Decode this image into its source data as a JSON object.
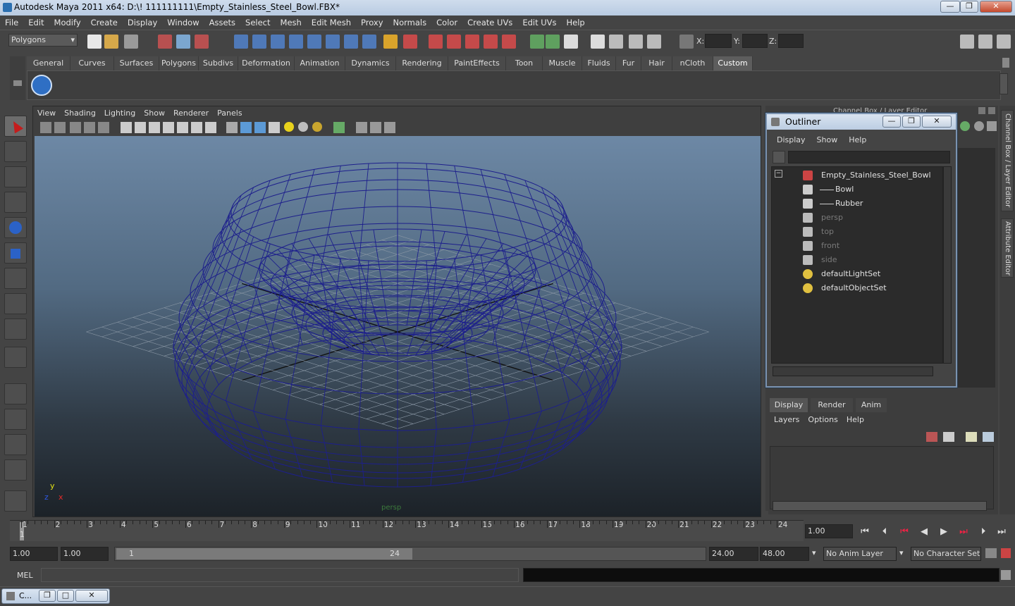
{
  "window": {
    "title": "Autodesk Maya 2011 x64: D:\\! 111111111\\Empty_Stainless_Steel_Bowl.FBX*",
    "minimize": "—",
    "maximize": "❐",
    "close": "✕"
  },
  "menubar": [
    "File",
    "Edit",
    "Modify",
    "Create",
    "Display",
    "Window",
    "Assets",
    "Select",
    "Mesh",
    "Edit Mesh",
    "Proxy",
    "Normals",
    "Color",
    "Create UVs",
    "Edit UVs",
    "Help"
  ],
  "toolbar": {
    "mode": "Polygons",
    "x_label": "X:",
    "y_label": "Y:",
    "z_label": "Z:",
    "x_value": "",
    "y_value": "",
    "z_value": ""
  },
  "shelf": {
    "tabs": [
      "General",
      "Curves",
      "Surfaces",
      "Polygons",
      "Subdivs",
      "Deformation",
      "Animation",
      "Dynamics",
      "Rendering",
      "PaintEffects",
      "Toon",
      "Muscle",
      "Fluids",
      "Fur",
      "Hair",
      "nCloth",
      "Custom"
    ],
    "active": "Custom"
  },
  "viewport": {
    "menu": [
      "View",
      "Shading",
      "Lighting",
      "Show",
      "Renderer",
      "Panels"
    ],
    "camera_label": "persp",
    "axis_x": "x",
    "axis_y": "y",
    "axis_z": "z"
  },
  "outliner": {
    "title": "Outliner",
    "menu": [
      "Display",
      "Show",
      "Help"
    ],
    "items": [
      {
        "label": "Empty_Stainless_Steel_Bowl",
        "indent": 0,
        "dim": false,
        "icon": "transform-icon"
      },
      {
        "label": "Bowl",
        "indent": 1,
        "dim": false,
        "icon": "mesh-icon"
      },
      {
        "label": "Rubber",
        "indent": 1,
        "dim": false,
        "icon": "mesh-icon"
      },
      {
        "label": "persp",
        "indent": 0,
        "dim": true,
        "icon": "camera-icon"
      },
      {
        "label": "top",
        "indent": 0,
        "dim": true,
        "icon": "camera-icon"
      },
      {
        "label": "front",
        "indent": 0,
        "dim": true,
        "icon": "camera-icon"
      },
      {
        "label": "side",
        "indent": 0,
        "dim": true,
        "icon": "camera-icon"
      },
      {
        "label": "defaultLightSet",
        "indent": 0,
        "dim": false,
        "icon": "set-icon"
      },
      {
        "label": "defaultObjectSet",
        "indent": 0,
        "dim": false,
        "icon": "set-icon"
      }
    ]
  },
  "channel_box": {
    "header": "Channel Box / Layer Editor"
  },
  "side_tabs": [
    "Channel Box / Layer Editor",
    "Attribute Editor"
  ],
  "layers": {
    "tabs": [
      "Display",
      "Render",
      "Anim"
    ],
    "active": "Display",
    "menu": [
      "Layers",
      "Options",
      "Help"
    ]
  },
  "timeline": {
    "ticks": [
      "1",
      "2",
      "3",
      "4",
      "5",
      "6",
      "7",
      "8",
      "9",
      "10",
      "11",
      "12",
      "13",
      "14",
      "15",
      "16",
      "17",
      "18",
      "19",
      "20",
      "21",
      "22",
      "23",
      "24"
    ],
    "current_frame": "1",
    "current_time": "1.00"
  },
  "range": {
    "start": "1.00",
    "anim_start": "1.00",
    "slider_start": "1",
    "slider_end": "24",
    "anim_end": "24.00",
    "end": "48.00",
    "anim_layer": "No Anim Layer",
    "character_set": "No Character Set"
  },
  "command": {
    "label": "MEL",
    "input": "",
    "output": ""
  },
  "taskbar": {
    "item": "C..."
  },
  "colors": {
    "wire": "#1d1f8c",
    "title_bg": "#c4d4e8",
    "viewport_top": "#6d88a5",
    "viewport_bottom": "#1c2228",
    "active_tab": "#5d5d5d"
  }
}
